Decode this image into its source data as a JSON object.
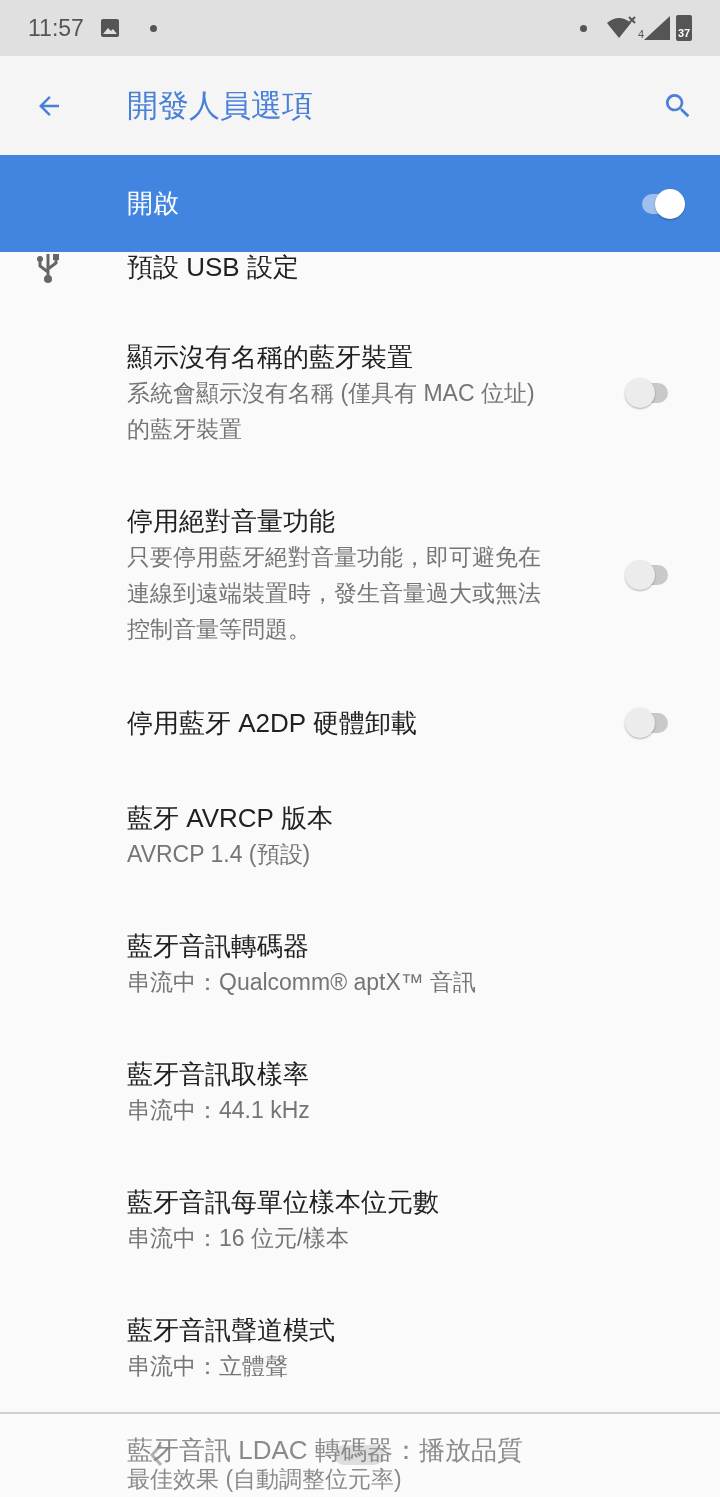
{
  "status_bar": {
    "time": "11:57",
    "wifi_badge": "4",
    "battery": "37"
  },
  "app_bar": {
    "title": "開發人員選項"
  },
  "master_switch": {
    "label": "開啟",
    "on": true
  },
  "settings": [
    {
      "kind": "icon",
      "title": "預設 USB 設定"
    },
    {
      "kind": "toggle",
      "title": "顯示沒有名稱的藍牙裝置",
      "subtitle": "系統會顯示沒有名稱 (僅具有 MAC 位址) 的藍牙裝置",
      "on": false
    },
    {
      "kind": "toggle",
      "title": "停用絕對音量功能",
      "subtitle": "只要停用藍牙絕對音量功能，即可避免在連線到遠端裝置時，發生音量過大或無法控制音量等問題。",
      "on": false
    },
    {
      "kind": "toggle",
      "title": "停用藍牙 A2DP 硬體卸載",
      "on": false
    },
    {
      "kind": "text",
      "title": "藍牙 AVRCP 版本",
      "subtitle": "AVRCP 1.4 (預設)"
    },
    {
      "kind": "text",
      "title": "藍牙音訊轉碼器",
      "subtitle": "串流中：Qualcomm® aptX™ 音訊"
    },
    {
      "kind": "text",
      "title": "藍牙音訊取樣率",
      "subtitle": "串流中：44.1 kHz"
    },
    {
      "kind": "text",
      "title": "藍牙音訊每單位樣本位元數",
      "subtitle": "串流中：16 位元/樣本"
    },
    {
      "kind": "text",
      "title": "藍牙音訊聲道模式",
      "subtitle": "串流中：立體聲"
    },
    {
      "kind": "text",
      "title": "藍牙音訊 LDAC 轉碼器：播放品質",
      "subtitle": "最佳效果 (自動調整位元率)"
    }
  ]
}
